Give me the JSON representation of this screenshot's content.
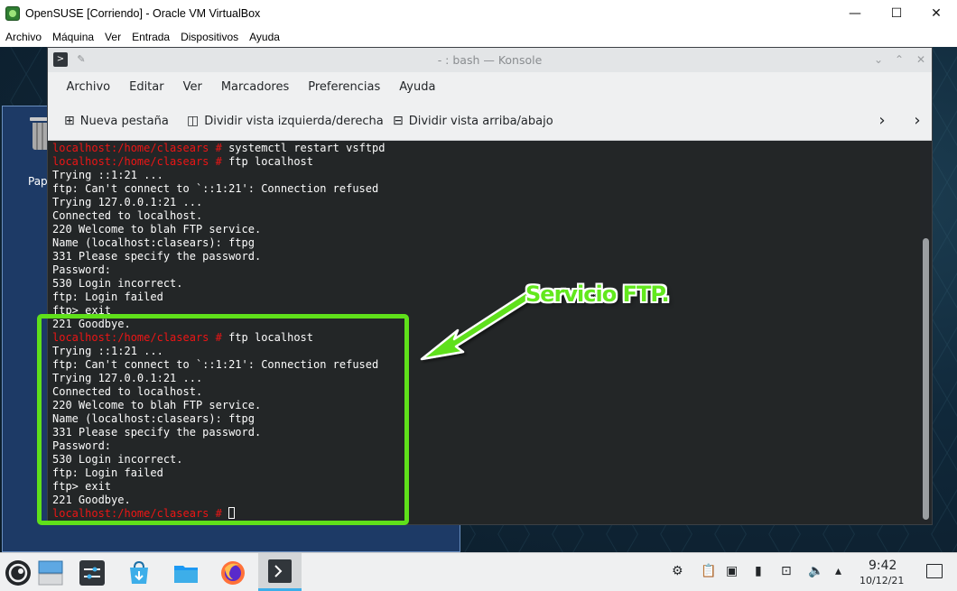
{
  "host": {
    "title": "OpenSUSE [Corriendo] - Oracle VM VirtualBox",
    "menu": [
      "Archivo",
      "Máquina",
      "Ver",
      "Entrada",
      "Dispositivos",
      "Ayuda"
    ],
    "controls": {
      "minimize": "—",
      "maximize": "☐",
      "close": "✕"
    }
  },
  "desktop": {
    "folder_label": "Pap"
  },
  "konsole": {
    "title": "- : bash — Konsole",
    "menu": [
      "Archivo",
      "Editar",
      "Ver",
      "Marcadores",
      "Preferencias",
      "Ayuda"
    ],
    "toolbar": {
      "new_tab": "Nueva pestaña",
      "split_lr": "Dividir vista izquierda/derecha",
      "split_tb": "Dividir vista arriba/abajo"
    },
    "prompt": "localhost:/home/clasears # ",
    "lines": [
      {
        "prompt": true,
        "text": "systemctl restart vsftpd"
      },
      {
        "prompt": true,
        "text": "ftp localhost"
      },
      {
        "prompt": false,
        "text": "Trying ::1:21 ..."
      },
      {
        "prompt": false,
        "text": "ftp: Can't connect to `::1:21': Connection refused"
      },
      {
        "prompt": false,
        "text": "Trying 127.0.0.1:21 ..."
      },
      {
        "prompt": false,
        "text": "Connected to localhost."
      },
      {
        "prompt": false,
        "text": "220 Welcome to blah FTP service."
      },
      {
        "prompt": false,
        "text": "Name (localhost:clasears): ftpg"
      },
      {
        "prompt": false,
        "text": "331 Please specify the password."
      },
      {
        "prompt": false,
        "text": "Password:"
      },
      {
        "prompt": false,
        "text": "530 Login incorrect."
      },
      {
        "prompt": false,
        "text": "ftp: Login failed"
      },
      {
        "prompt": false,
        "text": "ftp> exit"
      },
      {
        "prompt": false,
        "text": "221 Goodbye."
      },
      {
        "prompt": true,
        "text": "ftp localhost"
      },
      {
        "prompt": false,
        "text": "Trying ::1:21 ..."
      },
      {
        "prompt": false,
        "text": "ftp: Can't connect to `::1:21': Connection refused"
      },
      {
        "prompt": false,
        "text": "Trying 127.0.0.1:21 ..."
      },
      {
        "prompt": false,
        "text": "Connected to localhost."
      },
      {
        "prompt": false,
        "text": "220 Welcome to blah FTP service."
      },
      {
        "prompt": false,
        "text": "Name (localhost:clasears): ftpg"
      },
      {
        "prompt": false,
        "text": "331 Please specify the password."
      },
      {
        "prompt": false,
        "text": "Password:"
      },
      {
        "prompt": false,
        "text": "530 Login incorrect."
      },
      {
        "prompt": false,
        "text": "ftp: Login failed"
      },
      {
        "prompt": false,
        "text": "ftp> exit"
      },
      {
        "prompt": false,
        "text": "221 Goodbye."
      },
      {
        "prompt": true,
        "text": "",
        "cursor": true
      }
    ]
  },
  "annotation": {
    "text": "Servicio FTP.",
    "color": "#5fe01a"
  },
  "taskbar": {
    "clock_time": "9:42",
    "clock_date": "10/12/21"
  },
  "colors": {
    "prompt": "#ed1515",
    "terminal_bg": "#232627",
    "terminal_fg": "#fcfcfc"
  }
}
